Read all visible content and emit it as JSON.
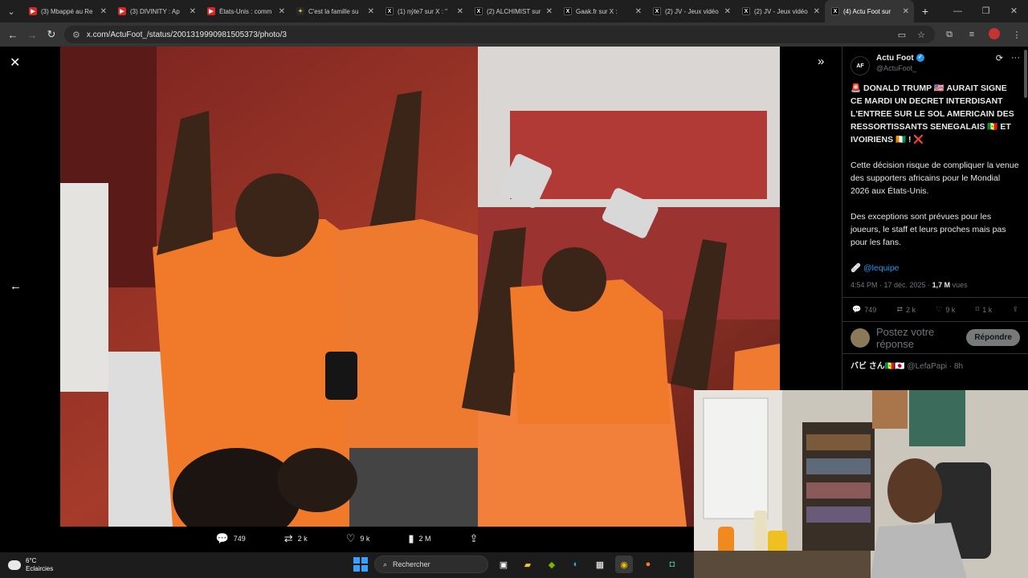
{
  "browser": {
    "tabs": [
      {
        "label": "(3) Mbappé au Re",
        "icon": "youtube-icon",
        "active": false
      },
      {
        "label": "(3) DIVINITY : Ap",
        "icon": "youtube-icon",
        "active": false
      },
      {
        "label": "États-Unis : comm",
        "icon": "youtube-icon",
        "active": false
      },
      {
        "label": "C'est la famille su",
        "icon": "site-icon",
        "active": false
      },
      {
        "label": "(1) nýte7 sur X : \"",
        "icon": "x-icon",
        "active": false
      },
      {
        "label": "(2) ALCHIMIST sur",
        "icon": "x-icon",
        "active": false
      },
      {
        "label": "Gaak.fr sur X :",
        "icon": "x-icon",
        "active": false
      },
      {
        "label": "(2) JV - Jeux vidéo",
        "icon": "x-icon",
        "active": false
      },
      {
        "label": "(2) JV - Jeux vidéo",
        "icon": "x-icon",
        "active": false
      },
      {
        "label": "(4) Actu Foot sur",
        "icon": "x-icon",
        "active": true
      }
    ],
    "url": "x.com/ActuFoot_/status/2001319990981505373/photo/3"
  },
  "viewer": {
    "actions": {
      "replies": "749",
      "reposts": "2 k",
      "likes": "9 k",
      "views": "2 M"
    }
  },
  "tweet": {
    "author_name": "Actu Foot",
    "author_handle": "@ActuFoot_",
    "logo_text": "AF",
    "headline": "🚨 DONALD TRUMP 🇺🇸 AURAIT SIGNE CE MARDI UN DECRET INTERDISANT L'ENTREE SUR LE SOL AMERICAIN DES RESSORTISSANTS SENEGALAIS 🇸🇳 ET IVOIRIENS 🇨🇮 ! ❌",
    "para1": "Cette décision risque de compliquer la venue des supporters africains pour le Mondial 2026 aux États-Unis.",
    "para2": "Des exceptions sont prévues pour les joueurs, le staff et leurs proches mais pas pour les fans.",
    "link": "🩹 @lequipe",
    "timestamp": "4:54 PM · 17 déc. 2025 · ",
    "views_count": "1,7 M",
    "views_label": " vues",
    "stats": {
      "replies": "749",
      "reposts": "2 k",
      "likes": "9 k",
      "bookmarks": "1 k"
    },
    "reply_placeholder": "Postez votre réponse",
    "reply_button": "Répondre",
    "next_reply_name": "バビ さん🇸🇳🇯🇵",
    "next_reply_handle": "@LefaPapi · 8h"
  },
  "taskbar": {
    "temp": "6°C",
    "weather": "Eclaircies",
    "search_label": "Rechercher"
  },
  "colors": {
    "jersey": "#f07a2a",
    "accent": "#1d9bf0"
  }
}
